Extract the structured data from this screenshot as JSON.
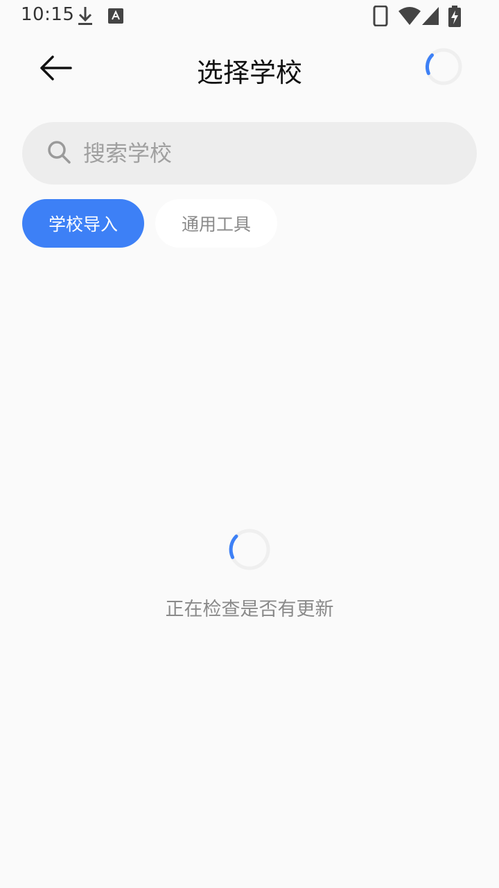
{
  "status_bar": {
    "time": "10:15",
    "icons": [
      "download-icon",
      "keyboard-a-icon",
      "phone-icon",
      "wifi-icon",
      "signal-icon",
      "battery-charging-icon"
    ]
  },
  "header": {
    "title": "选择学校",
    "back_icon": "arrow-left-icon",
    "loading": true
  },
  "search": {
    "placeholder": "搜索学校",
    "value": "",
    "icon": "search-icon"
  },
  "tabs": [
    {
      "label": "学校导入",
      "active": true
    },
    {
      "label": "通用工具",
      "active": false
    }
  ],
  "loading": {
    "text": "正在检查是否有更新"
  },
  "colors": {
    "accent": "#3d80f6",
    "background": "#fafafa",
    "search_bg": "#ededed"
  }
}
